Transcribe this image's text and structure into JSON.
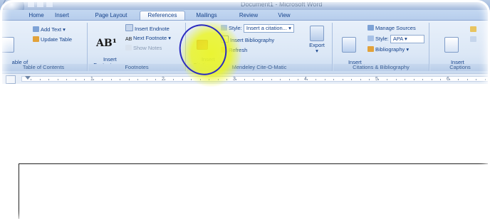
{
  "window": {
    "title": "Document1 - Microsoft Word"
  },
  "tabs": [
    "Home",
    "Insert",
    "Page Layout",
    "References",
    "Mailings",
    "Review",
    "View"
  ],
  "active_tab": "References",
  "ribbon": {
    "toc": {
      "table_of_contents_label": "able of\nntents",
      "add_text": "Add Text",
      "update_table": "Update Table",
      "group_label": "Table of Contents"
    },
    "footnotes": {
      "insert_footnote": "Insert\nFootnote",
      "insert_endnote": "Insert Endnote",
      "next_footnote": "Next Footnote",
      "show_notes": "Show Notes",
      "group_label": "Footnotes"
    },
    "mendeley": {
      "insert_citation": "Insert\nCitation",
      "style_label": "Style:",
      "style_value": "Insert a citation...",
      "insert_bibliography": "Insert Bibliography",
      "refresh": "Refresh",
      "export": "Export",
      "group_label": "Mendeley Cite-O-Matic"
    },
    "citations": {
      "insert_citation": "Insert\nCitation",
      "manage_sources": "Manage Sources",
      "style_label": "Style:",
      "style_value": "APA",
      "bibliography": "Bibliography",
      "group_label": "Citations & Bibliography"
    },
    "captions": {
      "insert_caption": "Insert\nCaption",
      "group_label": "Captions"
    }
  },
  "ruler": {
    "numbers": [
      "1",
      "2",
      "3",
      "4",
      "5",
      "6"
    ]
  },
  "colors": {
    "annotation_highlight": "#ebf528",
    "annotation_circle": "#2b2bbf",
    "ribbon_text": "#15428b"
  }
}
